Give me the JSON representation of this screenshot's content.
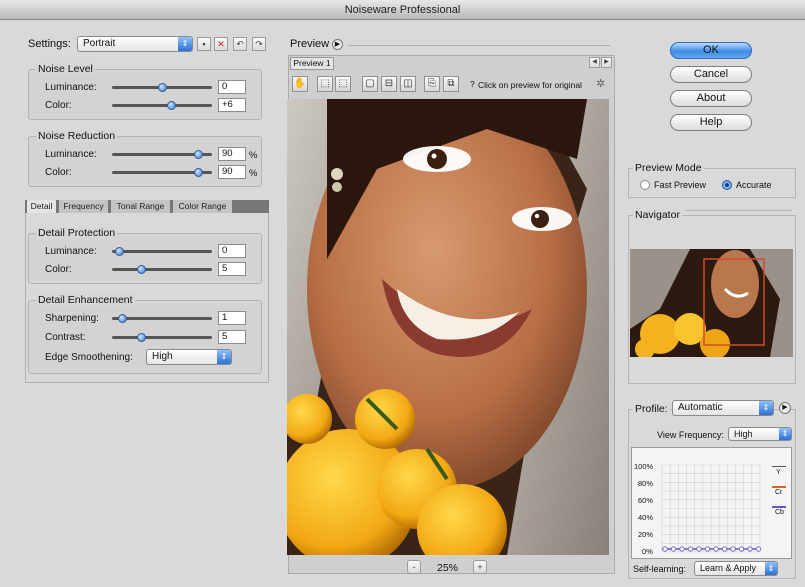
{
  "window": {
    "title": "Noiseware Professional"
  },
  "settings": {
    "label": "Settings:",
    "preset": "Portrait"
  },
  "noise_level": {
    "title": "Noise Level",
    "luminance_label": "Luminance:",
    "luminance_value": "0",
    "color_label": "Color:",
    "color_value": "+6",
    "luminance_level": 0.5,
    "color_level": 0.6
  },
  "noise_reduction": {
    "title": "Noise Reduction",
    "luminance_label": "Luminance:",
    "luminance_value": "90",
    "color_label": "Color:",
    "color_value": "90",
    "percent": "%",
    "luminance_level": 0.9,
    "color_level": 0.9
  },
  "tabs": [
    "Detail",
    "Frequency",
    "Tonal Range",
    "Color Range"
  ],
  "detail_protection": {
    "title": "Detail Protection",
    "luminance_label": "Luminance:",
    "luminance_value": "0",
    "color_label": "Color:",
    "color_value": "5",
    "luminance_level": 0.03,
    "color_level": 0.28
  },
  "detail_enhancement": {
    "title": "Detail Enhancement",
    "sharpening_label": "Sharpening:",
    "sharpening_value": "1",
    "contrast_label": "Contrast:",
    "contrast_value": "5",
    "edge_label": "Edge Smoothening:",
    "edge_value": "High",
    "sharpening_level": 0.07,
    "contrast_level": 0.28
  },
  "preview": {
    "title": "Preview",
    "tab": "Preview 1",
    "hint": "Click on preview for original",
    "hint_icon": "?",
    "zoom": "25%",
    "minus": "-",
    "plus": "+"
  },
  "buttons": {
    "ok": "OK",
    "cancel": "Cancel",
    "about": "About",
    "help": "Help"
  },
  "preview_mode": {
    "title": "Preview Mode",
    "fast": "Fast Preview",
    "accurate": "Accurate",
    "selected": "Accurate"
  },
  "navigator": {
    "title": "Navigator"
  },
  "profile": {
    "label": "Profile:",
    "value": "Automatic",
    "view_frequency_label": "View Frequency:",
    "view_frequency_value": "High",
    "y_ticks": [
      "100%",
      "80%",
      "60%",
      "40%",
      "20%",
      "0%"
    ],
    "legend": [
      "Y",
      "Cr",
      "Cb"
    ],
    "self_learning_label": "Self-learning:",
    "self_learning_value": "Learn & Apply"
  },
  "colors": {
    "accent": "#3f8de6",
    "y": "#555555",
    "cr": "#d9622b",
    "cb": "#6a55c8"
  }
}
